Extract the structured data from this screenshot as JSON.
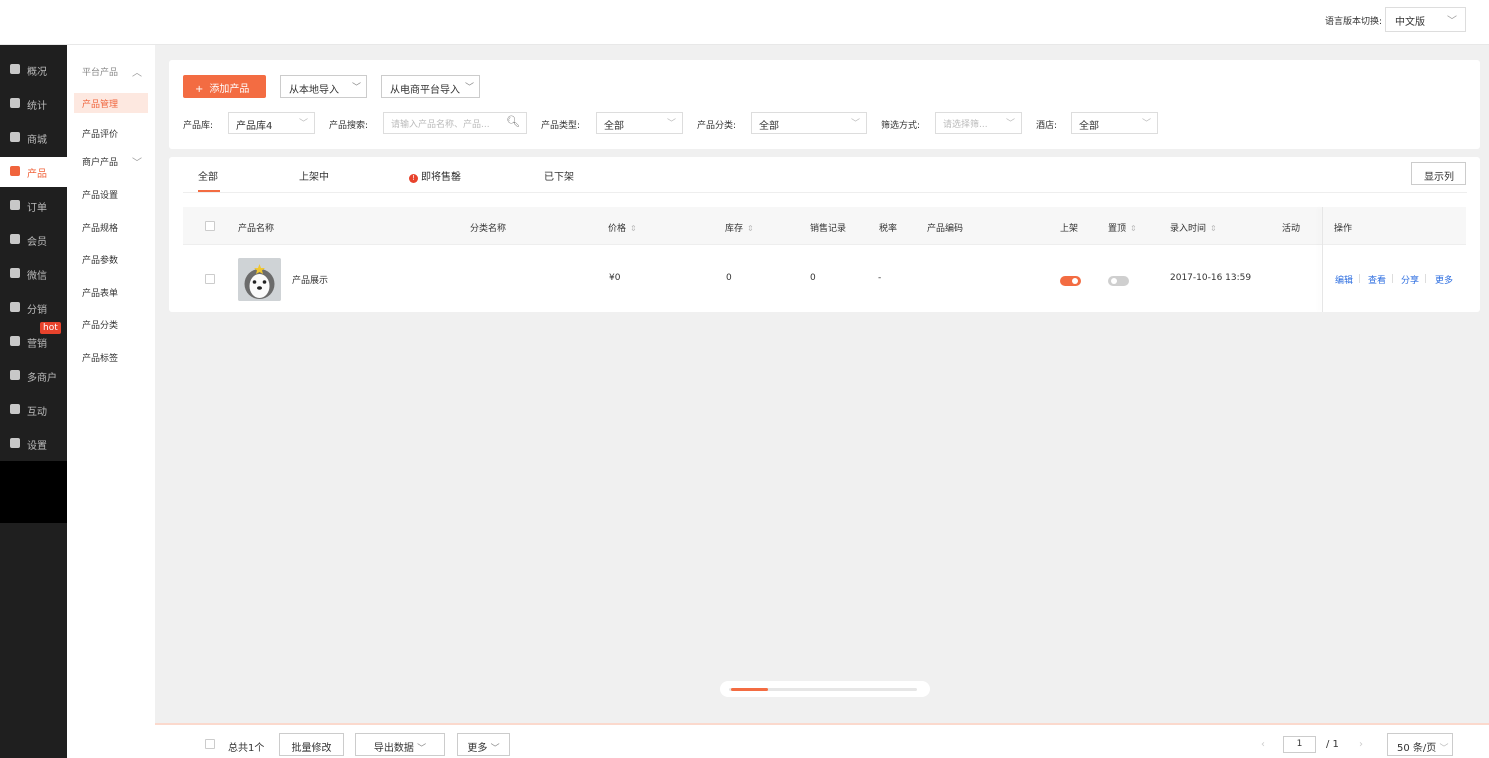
{
  "header": {
    "lang_label": "语言版本切换:",
    "lang_value": "中文版"
  },
  "sidebar": {
    "items": [
      {
        "label": "概况",
        "icon": "layers-icon"
      },
      {
        "label": "统计",
        "icon": "chart-icon"
      },
      {
        "label": "商城",
        "icon": "shop-icon"
      },
      {
        "label": "产品",
        "icon": "grid-icon",
        "active": true
      },
      {
        "label": "订单",
        "icon": "order-icon"
      },
      {
        "label": "会员",
        "icon": "crown-icon"
      },
      {
        "label": "微信",
        "icon": "wechat-icon"
      },
      {
        "label": "分销",
        "icon": "people-icon"
      },
      {
        "label": "营销",
        "icon": "flag-icon",
        "badge": "hot"
      },
      {
        "label": "多商户",
        "icon": "store-icon"
      },
      {
        "label": "互动",
        "icon": "interact-icon"
      },
      {
        "label": "设置",
        "icon": "gear-icon"
      }
    ]
  },
  "subnav": {
    "group1": "平台产品",
    "manage": "产品管理",
    "review": "产品评价",
    "group2": "商户产品",
    "settings": "产品设置",
    "spec": "产品规格",
    "params": "产品参数",
    "form": "产品表单",
    "category": "产品分类",
    "tags": "产品标签"
  },
  "toolbar": {
    "add": "添加产品",
    "import_local": "从本地导入",
    "import_platform": "从电商平台导入"
  },
  "filters": {
    "library_label": "产品库:",
    "library_value": "产品库4",
    "search_label": "产品搜索:",
    "search_placeholder": "请输入产品名称、产品...",
    "type_label": "产品类型:",
    "type_value": "全部",
    "category_label": "产品分类:",
    "category_value": "全部",
    "filter_label": "筛选方式:",
    "filter_placeholder": "请选择筛...",
    "hotel_label": "酒店:",
    "hotel_value": "全部"
  },
  "tabs": {
    "all": "全部",
    "on_sale": "上架中",
    "sold_out_soon": "即将售罄",
    "off_shelf": "已下架",
    "show_columns": "显示列"
  },
  "table": {
    "headers": {
      "name": "产品名称",
      "category": "分类名称",
      "price": "价格",
      "stock": "库存",
      "sales": "销售记录",
      "tax": "税率",
      "code": "产品编码",
      "listed": "上架",
      "pinned": "置顶",
      "created": "录入时间",
      "activity": "活动",
      "ops": "操作"
    },
    "rows": [
      {
        "name": "产品展示",
        "price": "¥0",
        "stock": "0",
        "sales": "0",
        "tax": "-",
        "listed": true,
        "pinned": false,
        "created": "2017-10-16 13:59",
        "ops": [
          "编辑",
          "查看",
          "分享",
          "更多"
        ]
      }
    ]
  },
  "footer": {
    "total": "总共1个",
    "batch_edit": "批量修改",
    "export": "导出数据",
    "more": "更多",
    "page_current": "1",
    "page_total": "/ 1",
    "per_page": "50 条/页"
  },
  "colors": {
    "accent": "#f36c42",
    "sidebar_bg": "#1f1f1f",
    "link": "#2d6ee0"
  }
}
